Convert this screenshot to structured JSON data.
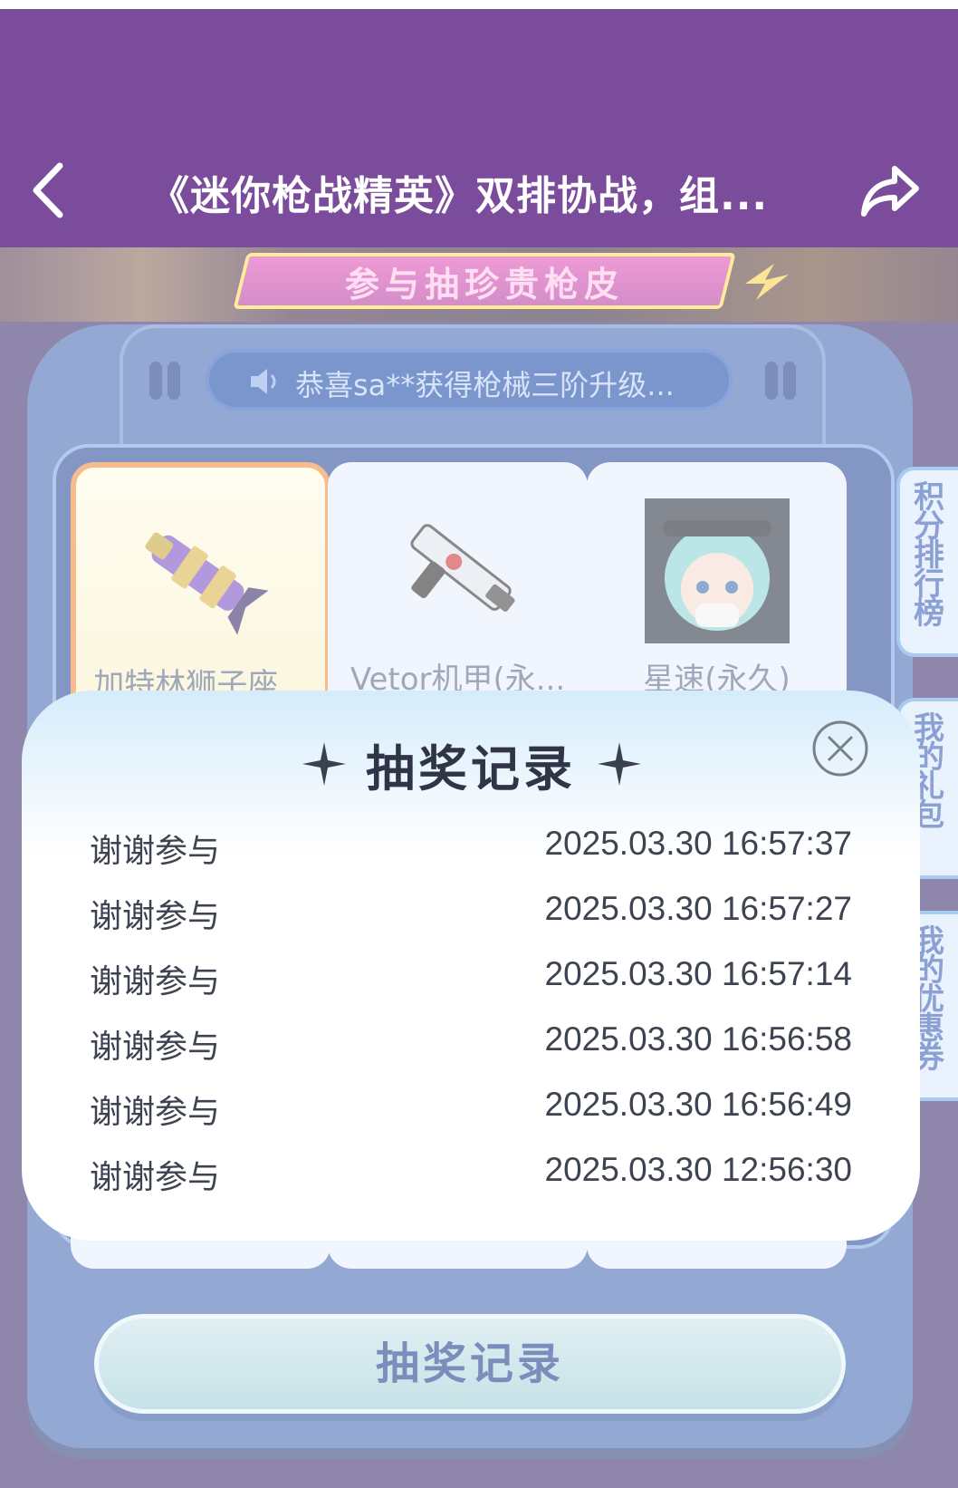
{
  "header": {
    "title": "《迷你枪战精英》双排协战，组...",
    "back_icon": "chevron-left-icon",
    "share_icon": "share-arrow-icon"
  },
  "banner": {
    "text": "参与抽珍贵枪皮"
  },
  "marquee": {
    "text": "恭喜sa**获得枪械三阶升级..."
  },
  "prizes": [
    {
      "label": "加特林狮子座...",
      "icon": "gatling-gun-icon"
    },
    {
      "label": "Vetor机甲(永...",
      "icon": "smg-gun-icon"
    },
    {
      "label": "星速(永久)",
      "icon": "character-avatar-icon"
    }
  ],
  "side_tabs": [
    {
      "label": "积分排行榜"
    },
    {
      "label": "我的礼包"
    },
    {
      "label": "我的优惠券"
    }
  ],
  "draw_record_button": "抽奖记录",
  "modal": {
    "title": "抽奖记录",
    "records": [
      {
        "label": "谢谢参与",
        "time": "2025.03.30 16:57:37"
      },
      {
        "label": "谢谢参与",
        "time": "2025.03.30 16:57:27"
      },
      {
        "label": "谢谢参与",
        "time": "2025.03.30 16:57:14"
      },
      {
        "label": "谢谢参与",
        "time": "2025.03.30 16:56:58"
      },
      {
        "label": "谢谢参与",
        "time": "2025.03.30 16:56:49"
      },
      {
        "label": "谢谢参与",
        "time": "2025.03.30 12:56:30"
      }
    ]
  },
  "colors": {
    "header_bg": "#7a4c9b",
    "page_bg": "#3d2f6e",
    "panel_blue": "#4869b6",
    "button_text": "#1e3c8c"
  }
}
